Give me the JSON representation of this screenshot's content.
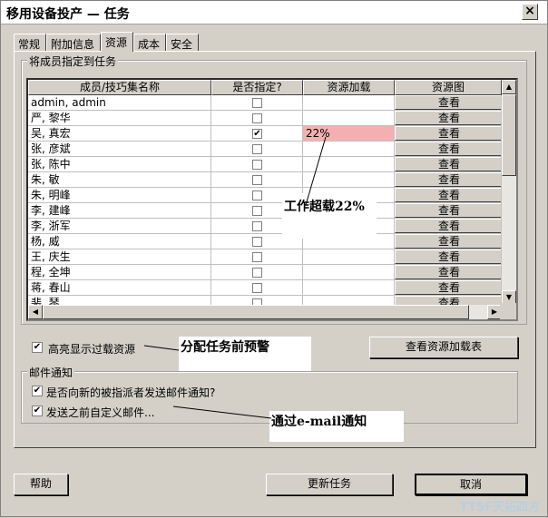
{
  "window": {
    "title": "移用设备投产 — 任务",
    "close": "×"
  },
  "tabs": [
    "常规",
    "附加信息",
    "资源",
    "成本",
    "安全"
  ],
  "assign_group": "将成员指定到任务",
  "table": {
    "headers": [
      "成员/技巧集名称",
      "是否指定?",
      "资源加载",
      "资源图"
    ],
    "view_label": "查看",
    "rows": [
      {
        "name": "admin, admin",
        "checked": false,
        "load": ""
      },
      {
        "name": "严, 黎华",
        "checked": false,
        "load": ""
      },
      {
        "name": "吴, 真宏",
        "checked": true,
        "load": "22%"
      },
      {
        "name": "张, 彦斌",
        "checked": false,
        "load": ""
      },
      {
        "name": "张, 陈中",
        "checked": false,
        "load": ""
      },
      {
        "name": "朱, 敏",
        "checked": false,
        "load": ""
      },
      {
        "name": "朱, 明峰",
        "checked": false,
        "load": ""
      },
      {
        "name": "李, 建峰",
        "checked": false,
        "load": ""
      },
      {
        "name": "李, 浙军",
        "checked": false,
        "load": ""
      },
      {
        "name": "杨, 威",
        "checked": false,
        "load": ""
      },
      {
        "name": "王, 庆生",
        "checked": false,
        "load": ""
      },
      {
        "name": "程, 全坤",
        "checked": false,
        "load": ""
      },
      {
        "name": "蒋, 春山",
        "checked": false,
        "load": ""
      },
      {
        "name": "裴, 琴",
        "checked": false,
        "load": ""
      }
    ]
  },
  "highlight": {
    "label": "高亮显示过载资源",
    "checked": true
  },
  "view_load_button": "查看资源加载表",
  "mail_group": "邮件通知",
  "mail_options": [
    {
      "label": "是否向新的被指派者发送邮件通知?",
      "checked": true
    },
    {
      "label": "发送之前自定义邮件...",
      "checked": true
    }
  ],
  "annotations": {
    "overload": "工作超载22%",
    "warn": "分配任务前预警",
    "email": "通过e-mail通知"
  },
  "buttons": {
    "help": "帮助",
    "update": "更新任务",
    "cancel": "取消"
  },
  "watermark": "TTSF天拓四方",
  "colors": {
    "overload": "#f4b0b0"
  }
}
